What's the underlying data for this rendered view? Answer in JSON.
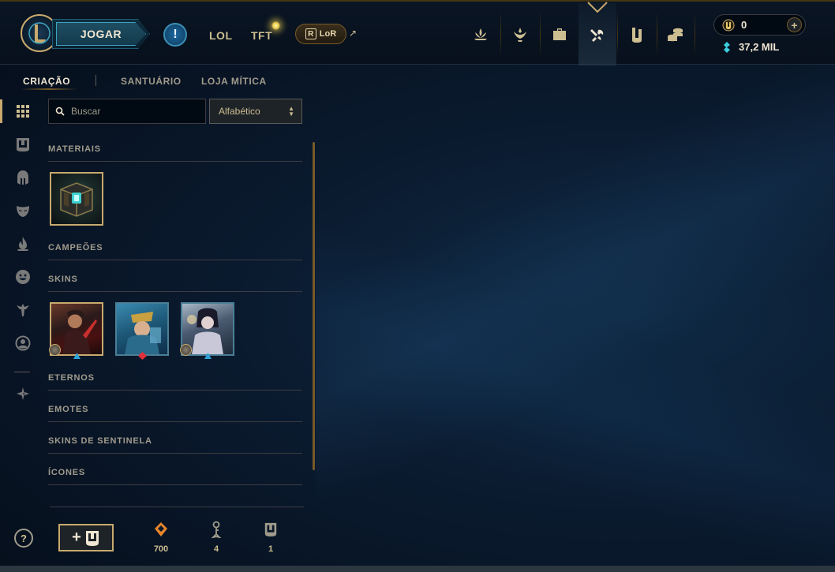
{
  "nav": {
    "play_label": "JOGAR",
    "alert_label": "!",
    "modes": [
      "LOL",
      "TFT"
    ],
    "lor_label": "LoR",
    "lor_icon_letter": "R",
    "external_arrow": "↗",
    "icons": [
      "clash-icon",
      "profile-icon",
      "collection-icon",
      "loot-icon",
      "tft-pass-icon",
      "store-icon"
    ],
    "active_icon": "loot-icon"
  },
  "wallet": {
    "rp": "0",
    "rp_plus": "+",
    "blue_essence": "37,2 MIL"
  },
  "subtabs": [
    {
      "label": "CRIAÇÃO",
      "active": true
    },
    {
      "label": "SANTUÁRIO",
      "active": false
    },
    {
      "label": "LOJA MÍTICA",
      "active": false
    }
  ],
  "rail": [
    "all-icon",
    "chest-icon",
    "champion-helmet-icon",
    "skin-mask-icon",
    "eternals-flame-icon",
    "emote-icon",
    "ward-icon",
    "summoner-icon-icon",
    "other-icon"
  ],
  "search": {
    "placeholder": "Buscar"
  },
  "sort": {
    "selected": "Alfabético"
  },
  "sections": [
    {
      "label": "MATERIAIS"
    },
    {
      "label": "CAMPEÕES"
    },
    {
      "label": "SKINS"
    },
    {
      "label": "ETERNOS"
    },
    {
      "label": "EMOTES"
    },
    {
      "label": "SKINS DE SENTINELA"
    },
    {
      "label": "ÍCONES"
    }
  ],
  "materials": [
    {
      "name": "hextech-chest-icon"
    }
  ],
  "skins": [
    {
      "name": "skin-shard-1",
      "rarity": "blue"
    },
    {
      "name": "skin-shard-2",
      "rarity": "red"
    },
    {
      "name": "skin-shard-3",
      "rarity": "blue"
    }
  ],
  "footer": {
    "help": "?",
    "add_chest": "+",
    "currencies": [
      {
        "icon": "orange-essence-icon",
        "value": "700"
      },
      {
        "icon": "key-icon",
        "value": "4"
      },
      {
        "icon": "chest-icon",
        "value": "1"
      }
    ]
  },
  "colors": {
    "gold": "#c8aa6e",
    "text_gold": "#cdbe91",
    "hextech_blue": "#0ac8b9",
    "background": "#0a1a2e"
  }
}
